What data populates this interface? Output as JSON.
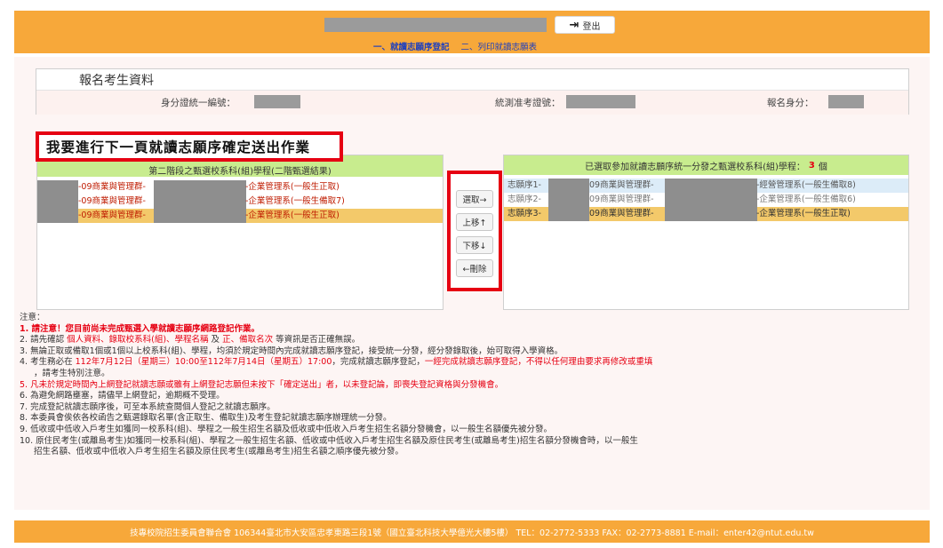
{
  "header": {
    "logout_label": "登出",
    "tab_register": "一、就讀志願序登記",
    "tab_print": "二、列印就讀志願表"
  },
  "info": {
    "title": "報名考生資料",
    "id_label": "身分證統一編號：",
    "exam_no_label": "統測准考證號：",
    "identity_label": "報名身分："
  },
  "heading": "我要進行下一頁就讀志願序確定送出作業",
  "left_panel": {
    "header": "第二階段之甄選校系科(組)學程(二階甄選結果)",
    "items": [
      {
        "prefix": "-09商業與管理群-",
        "suffix": "-企業管理系(一般生正取)",
        "selected": false
      },
      {
        "prefix": "-09商業與管理群-",
        "suffix": "-企業管理系(一般生備取7)",
        "selected": false
      },
      {
        "prefix": "-09商業與管理群-",
        "suffix": "-企業管理系(一般生正取)",
        "selected": true
      }
    ]
  },
  "buttons": {
    "select": "選取→",
    "up": "上移↑",
    "down": "下移↓",
    "delete": "←刪除"
  },
  "right_panel": {
    "header_before": "已選取參加就讀志願序統一分發之甄選校系科(組)學程：",
    "count": "3",
    "header_after": "個",
    "items": [
      {
        "order": "志願序1-",
        "group": "09商業與管理群-",
        "suffix": "-經營管理系(一般生備取8)"
      },
      {
        "order": "志願序2-",
        "group": "09商業與管理群-",
        "suffix": "-企業管理系(一般生備取6)"
      },
      {
        "order": "志願序3-",
        "group": "09商業與管理群-",
        "suffix": "-企業管理系(一般生正取)"
      }
    ]
  },
  "notes": {
    "title": "注意：",
    "n1": "1. 請注意！您目前尚未完成甄選入學就讀志願序網路登記作業。",
    "n2_a": "2. 請先確認 ",
    "n2_b": "個人資料、錄取校系科(組)、學程名稱",
    "n2_c": " 及 ",
    "n2_d": "正、備取名次",
    "n2_e": " 等資訊是否正確無誤。",
    "n3": "3. 無論正取或備取1個或1個以上校系科(組)、學程，均須於規定時間內完成就讀志願序登記，接受統一分發，經分發錄取後，始可取得入學資格。",
    "n4_a": "4. 考生務必在 ",
    "n4_b": "112年7月12日（星期三）10:00至112年7月14日（星期五）17:00",
    "n4_c": "，完成就讀志願序登記，",
    "n4_d": "一經完成就讀志願序登記，不得以任何理由要求再修改或重填",
    "n4_e": "，請考生特別注意。",
    "n5": "5. 凡未於規定時間內上網登記就讀志願或雖有上網登記志願但未按下「確定送出」者，以未登記論，即喪失登記資格與分發機會。",
    "n6": "6. 為避免網路壅塞，請儘早上網登記，逾期概不受理。",
    "n7": "7. 完成登記就讀志願序後，可至本系統查閱個人登記之就讀志願序。",
    "n8": "8. 本委員會俟依各校函告之甄選錄取名單(含正取生、備取生)及考生登記就讀志願序辦理統一分發。",
    "n9": "9. 低收或中低收入戶考生如獲同一校系科(組)、學程之一般生招生名額及低收或中低收入戶考生招生名額分發機會，以一般生名額優先被分發。",
    "n10_a": "10. 原住民考生(或離島考生)如獲同一校系科(組)、學程之一般生招生名額、低收或中低收入戶考生招生名額及原住民考生(或離島考生)招生名額分發機會時，以一般生",
    "n10_b": "招生名額、低收或中低收入戶考生招生名額及原住民考生(或離島考生)招生名額之順序優先被分發。"
  },
  "footer": "技專校院招生委員會聯合會 106344臺北市大安區忠孝東路三段1號（國立臺北科技大學億光大樓5樓） TEL：02-2772-5333 FAX：02-2773-8881 E-mail：enter42@ntut.edu.tw"
}
